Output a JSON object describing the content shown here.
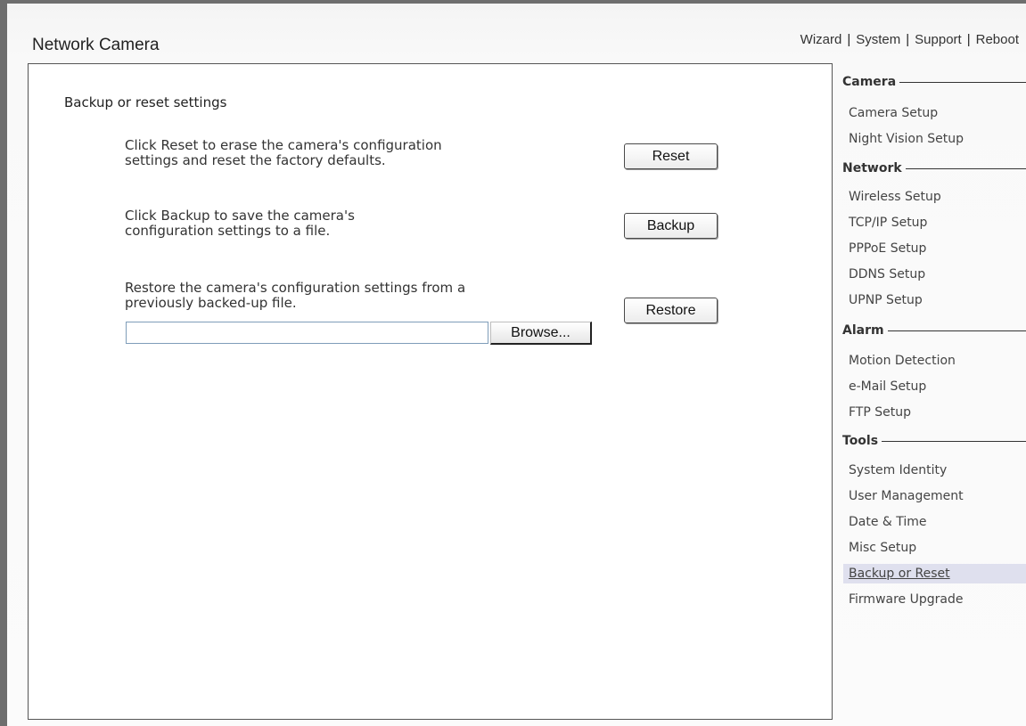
{
  "app_title": "Network Camera",
  "topnav": {
    "wizard": "Wizard",
    "system": "System",
    "support": "Support",
    "reboot": "Reboot",
    "separator": "|"
  },
  "main": {
    "section_title": "Backup or reset settings",
    "reset": {
      "line1": "Click Reset to erase the camera's configuration",
      "line2": "settings and reset the factory defaults.",
      "button": "Reset"
    },
    "backup": {
      "line1": "Click Backup to save the camera's",
      "line2": "configuration settings to a file.",
      "button": "Backup"
    },
    "restore": {
      "line1": "Restore the camera's configuration settings from a",
      "line2": "previously backed-up file.",
      "button": "Restore",
      "file_value": "",
      "browse_button": "Browse..."
    }
  },
  "sidebar": {
    "groups": [
      {
        "title": "Camera",
        "items": [
          "Camera Setup",
          "Night Vision Setup"
        ]
      },
      {
        "title": "Network",
        "items": [
          "Wireless Setup",
          "TCP/IP Setup",
          "PPPoE Setup",
          "DDNS Setup",
          "UPNP Setup"
        ]
      },
      {
        "title": "Alarm",
        "items": [
          "Motion Detection",
          "e-Mail Setup",
          "FTP Setup"
        ]
      },
      {
        "title": "Tools",
        "items": [
          "System Identity",
          "User Management",
          "Date & Time",
          "Misc Setup",
          "Backup or Reset",
          "Firmware Upgrade"
        ]
      }
    ],
    "active_item": "Backup or Reset"
  }
}
